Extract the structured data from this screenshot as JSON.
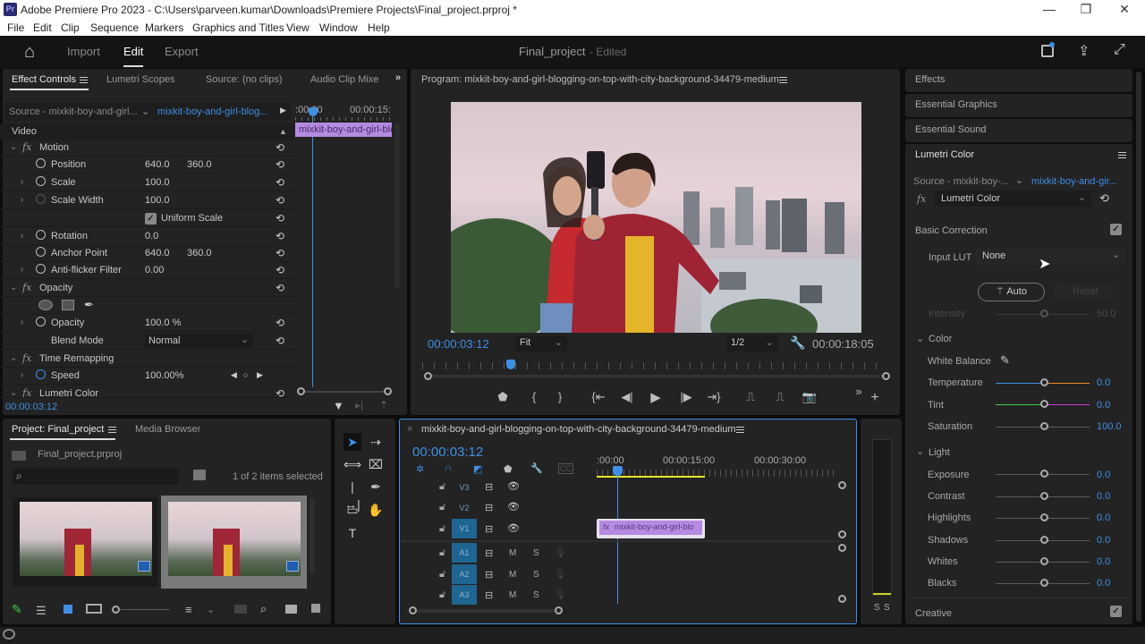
{
  "window": {
    "app_icon": "Pr",
    "title": "Adobe Premiere Pro 2023 - C:\\Users\\parveen.kumar\\Downloads\\Premiere Projects\\Final_project.prproj *",
    "minimize": "—",
    "restore": "❐",
    "close": "✕"
  },
  "menu": [
    "File",
    "Edit",
    "Clip",
    "Sequence",
    "Markers",
    "Graphics and Titles",
    "View",
    "Window",
    "Help"
  ],
  "header": {
    "home_icon": "⌂",
    "nav": [
      "Import",
      "Edit",
      "Export"
    ],
    "active_nav": "Edit",
    "project_name": "Final_project",
    "project_status": "- Edited"
  },
  "effect_controls": {
    "tabs": [
      "Effect Controls",
      "Lumetri Scopes",
      "Source: (no clips)",
      "Audio Clip Mixe"
    ],
    "more": "»",
    "source_label": "Source - mixkit-boy-and-girl...",
    "clip_label": "mixkit-boy-and-girl-blog...",
    "ruler_start": ":00:00",
    "ruler_mid": "00:00:15:",
    "clip_bar": "mixkit-boy-and-girl-blo",
    "section_video": "Video",
    "motion": "Motion",
    "properties": [
      {
        "name": "Position",
        "v1": "640.0",
        "v2": "360.0"
      },
      {
        "name": "Scale",
        "v1": "100.0",
        "v2": ""
      },
      {
        "name": "Scale Width",
        "v1": "100.0",
        "v2": ""
      },
      {
        "name": "Rotation",
        "v1": "0.0",
        "v2": ""
      },
      {
        "name": "Anchor Point",
        "v1": "640.0",
        "v2": "360.0"
      },
      {
        "name": "Anti-flicker Filter",
        "v1": "0.00",
        "v2": ""
      }
    ],
    "uniform_scale": "Uniform Scale",
    "opacity_section": "Opacity",
    "opacity_name": "Opacity",
    "opacity_value": "100.0 %",
    "blend_mode_label": "Blend Mode",
    "blend_mode_value": "Normal",
    "time_remapping": "Time Remapping",
    "speed_label": "Speed",
    "speed_value": "100.00%",
    "lumetri_label": "Lumetri Color",
    "timecode": "00:00:03:12"
  },
  "program": {
    "title": "Program: mixkit-boy-and-girl-blogging-on-top-with-city-background-34479-medium",
    "timecode": "00:00:03:12",
    "fit": "Fit",
    "resolution": "1/2",
    "duration": "00:00:18:05"
  },
  "right_panels": {
    "effects": "Effects",
    "essential_graphics": "Essential Graphics",
    "essential_sound": "Essential Sound",
    "lumetri_title": "Lumetri Color",
    "source_label": "Source - mixkit-boy-...",
    "clip_label": "mixkit-boy-and-gir...",
    "effect_select": "Lumetri Color",
    "basic_correction": "Basic Correction",
    "input_lut_label": "Input LUT",
    "input_lut_value": "None",
    "auto_button": "Auto",
    "reset_button": "Reset",
    "intensity_label": "Intensity",
    "intensity_value": "50.0",
    "color_section": "Color",
    "white_balance": "White Balance",
    "color_sliders": [
      {
        "label": "Temperature",
        "value": "0.0"
      },
      {
        "label": "Tint",
        "value": "0.0"
      },
      {
        "label": "Saturation",
        "value": "100.0"
      }
    ],
    "light_section": "Light",
    "light_sliders": [
      {
        "label": "Exposure",
        "value": "0.0"
      },
      {
        "label": "Contrast",
        "value": "0.0"
      },
      {
        "label": "Highlights",
        "value": "0.0"
      },
      {
        "label": "Shadows",
        "value": "0.0"
      },
      {
        "label": "Whites",
        "value": "0.0"
      },
      {
        "label": "Blacks",
        "value": "0.0"
      }
    ],
    "creative": "Creative"
  },
  "project": {
    "tabs": [
      "Project: Final_project",
      "Media Browser"
    ],
    "file": "Final_project.prproj",
    "search_placeholder": "",
    "selection": "1 of 2 items selected"
  },
  "timeline": {
    "title": "mixkit-boy-and-girl-blogging-on-top-with-city-background-34479-medium",
    "timecode": "00:00:03:12",
    "ruler": [
      ":00:00",
      "00:00:15:00",
      "00:00:30:00"
    ],
    "video_tracks": [
      "V3",
      "V2",
      "V1"
    ],
    "audio_tracks": [
      "A1",
      "A2",
      "A3"
    ],
    "clip": "mixkit-boy-and-girl-blo",
    "mute": "M",
    "solo": "S"
  },
  "audio_meter": {
    "solo_left": "S",
    "solo_right": "S"
  },
  "colors": {
    "accent": "#3f8fe6",
    "clip": "#b48be0",
    "track_on": "#1e6591",
    "work_area": "#e6e62a"
  }
}
